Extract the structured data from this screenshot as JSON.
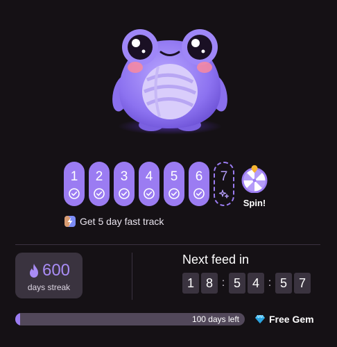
{
  "colors": {
    "accent": "#9b7cf2",
    "background": "#151115",
    "card": "#3a333f"
  },
  "days": [
    {
      "num": "1",
      "state": "done"
    },
    {
      "num": "2",
      "state": "done"
    },
    {
      "num": "3",
      "state": "done"
    },
    {
      "num": "4",
      "state": "done"
    },
    {
      "num": "5",
      "state": "done"
    },
    {
      "num": "6",
      "state": "done"
    },
    {
      "num": "7",
      "state": "upcoming"
    }
  ],
  "spin": {
    "label": "Spin!"
  },
  "fast_track": {
    "label": "Get 5 day fast track"
  },
  "streak": {
    "count": "600",
    "label": "days streak"
  },
  "feed": {
    "title": "Next feed in",
    "digits": [
      "1",
      "8",
      "5",
      "4",
      "5",
      "7"
    ]
  },
  "progress": {
    "label": "100 days left",
    "fraction": 0.02
  },
  "gem": {
    "label": "Free Gem"
  }
}
